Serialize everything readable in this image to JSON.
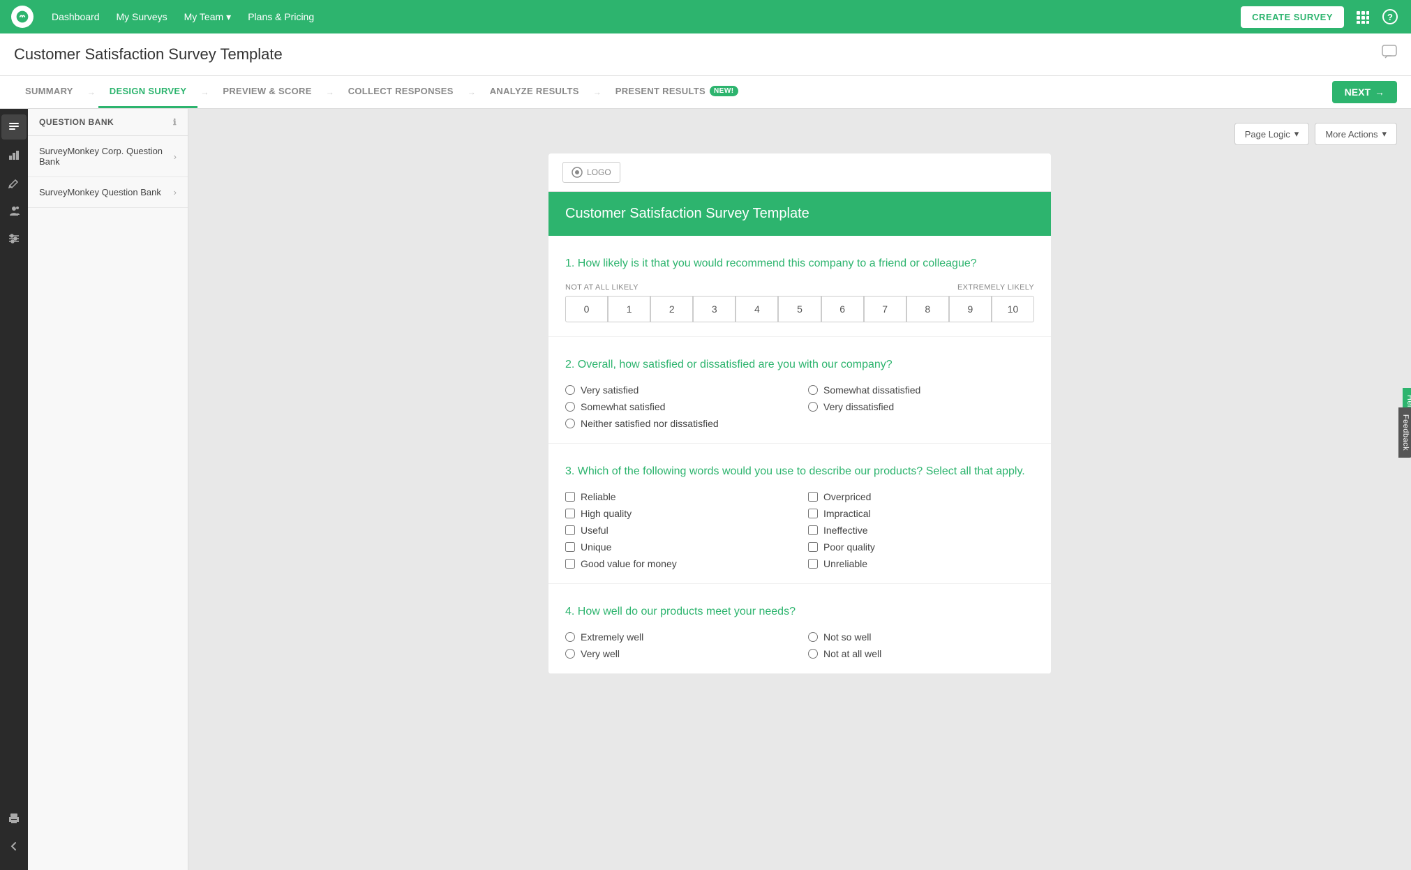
{
  "topNav": {
    "logo_alt": "SurveyMonkey",
    "links": [
      {
        "label": "Dashboard",
        "key": "dashboard"
      },
      {
        "label": "My Surveys",
        "key": "my-surveys"
      },
      {
        "label": "My Team",
        "key": "my-team",
        "hasDropdown": true
      },
      {
        "label": "Plans & Pricing",
        "key": "plans-pricing"
      }
    ],
    "create_survey_label": "CREATE SURVEY",
    "grid_icon": "⊞",
    "help_icon": "?"
  },
  "pageTitle": "Customer Satisfaction Survey Template",
  "tabs": [
    {
      "label": "SUMMARY",
      "key": "summary",
      "active": false
    },
    {
      "label": "DESIGN SURVEY",
      "key": "design-survey",
      "active": true
    },
    {
      "label": "PREVIEW & SCORE",
      "key": "preview-score",
      "active": false
    },
    {
      "label": "COLLECT RESPONSES",
      "key": "collect-responses",
      "active": false
    },
    {
      "label": "ANALYZE RESULTS",
      "key": "analyze-results",
      "active": false
    },
    {
      "label": "PRESENT RESULTS",
      "key": "present-results",
      "active": false,
      "badge": "NEW!"
    }
  ],
  "nextButton": "NEXT",
  "sidebarIcons": [
    {
      "name": "questions-icon",
      "symbol": "☰",
      "active": true
    },
    {
      "name": "chart-icon",
      "symbol": "📊",
      "active": false
    },
    {
      "name": "pencil-icon",
      "symbol": "✏️",
      "active": false
    },
    {
      "name": "people-icon",
      "symbol": "👤",
      "active": false
    },
    {
      "name": "sliders-icon",
      "symbol": "⚙",
      "active": false
    }
  ],
  "sidebarBottomIcons": [
    {
      "name": "print-icon",
      "symbol": "🖨",
      "active": false
    },
    {
      "name": "collapse-icon",
      "symbol": "◀",
      "active": false
    }
  ],
  "questionBank": {
    "header": "QUESTION BANK",
    "info_tooltip": "ℹ",
    "items": [
      {
        "label": "SurveyMonkey Corp. Question Bank",
        "key": "corp-bank"
      },
      {
        "label": "SurveyMonkey Question Bank",
        "key": "sm-bank"
      }
    ]
  },
  "toolbar": {
    "page_logic_label": "Page Logic",
    "more_actions_label": "More Actions",
    "chevron": "▾"
  },
  "survey": {
    "logo_label": "LOGO",
    "header_title": "Customer Satisfaction Survey Template",
    "header_bg": "#2db46e",
    "questions": [
      {
        "number": 1,
        "text": "How likely is it that you would recommend this company to a friend or colleague?",
        "type": "scale",
        "scale_min_label": "NOT AT ALL LIKELY",
        "scale_max_label": "EXTREMELY LIKELY",
        "scale_values": [
          "0",
          "1",
          "2",
          "3",
          "4",
          "5",
          "6",
          "7",
          "8",
          "9",
          "10"
        ]
      },
      {
        "number": 2,
        "text": "Overall, how satisfied or dissatisfied are you with our company?",
        "type": "radio",
        "options": [
          "Very satisfied",
          "Somewhat dissatisfied",
          "Somewhat satisfied",
          "Very dissatisfied",
          "Neither satisfied nor dissatisfied"
        ],
        "options_layout": "grid"
      },
      {
        "number": 3,
        "text": "Which of the following words would you use to describe our products? Select all that apply.",
        "type": "checkbox",
        "options": [
          "Reliable",
          "Overpriced",
          "High quality",
          "Impractical",
          "Useful",
          "Ineffective",
          "Unique",
          "Poor quality",
          "Good value for money",
          "Unreliable"
        ]
      },
      {
        "number": 4,
        "text": "How well do our products meet your needs?",
        "type": "radio",
        "options": [
          "Extremely well",
          "Not so well",
          "Very well",
          "Not at all well"
        ],
        "options_layout": "grid"
      }
    ]
  },
  "feedback": {
    "help_label": "Help!",
    "feedback_label": "Feedback"
  }
}
